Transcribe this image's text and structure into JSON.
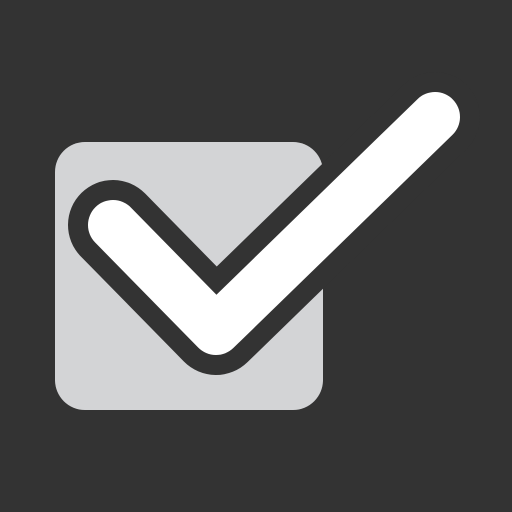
{
  "icon": {
    "name": "checkbox-checked-icon",
    "colors": {
      "background": "#333333",
      "box": "#d3d4d6",
      "check": "#ffffff",
      "check_outline": "#333333"
    }
  }
}
